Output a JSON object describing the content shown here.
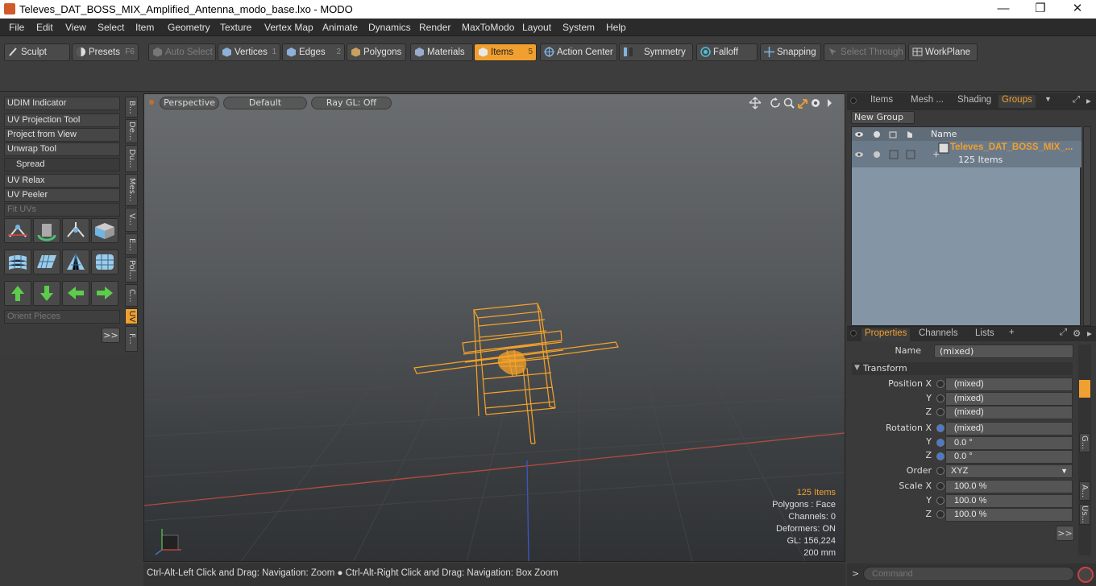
{
  "window": {
    "title": "Televes_DAT_BOSS_MIX_Amplified_Antenna_modo_base.lxo - MODO",
    "minimize": "—",
    "maximize": "❐",
    "close": "✕"
  },
  "menu": [
    "File",
    "Edit",
    "View",
    "Select",
    "Item",
    "Geometry",
    "Texture",
    "Vertex Map",
    "Animate",
    "Dynamics",
    "Render",
    "MaxToModo",
    "Layout",
    "System",
    "Help"
  ],
  "toolbar": {
    "sculpt": "Sculpt",
    "presets": "Presets",
    "presets_key": "F6",
    "auto_select": "Auto Select",
    "vertices": "Vertices",
    "vertices_key": "1",
    "edges": "Edges",
    "edges_key": "2",
    "polygons": "Polygons",
    "materials": "Materials",
    "items": "Items",
    "items_key": "5",
    "action_center": "Action Center",
    "symmetry": "Symmetry",
    "falloff": "Falloff",
    "snapping": "Snapping",
    "select_through": "Select Through",
    "workplane": "WorkPlane"
  },
  "left": {
    "buttons": [
      "UDIM Indicator",
      "UV Projection Tool",
      "Project from View",
      "Unwrap Tool",
      "Spread",
      "UV Relax",
      "UV Peeler",
      "Fit UVs"
    ],
    "orient": "Orient Pieces",
    "more": ">>",
    "tabs": [
      "B...",
      "De...",
      "Du...",
      "Mes...",
      "V...",
      "E...",
      "Pol...",
      "C...",
      "UV",
      "F..."
    ]
  },
  "viewport": {
    "perspective": "Perspective",
    "default": "Default",
    "raygl": "Ray GL: Off",
    "info": {
      "items": "125 Items",
      "polygons": "Polygons : Face",
      "channels": "Channels: 0",
      "deformers": "Deformers: ON",
      "gl": "GL: 156,224",
      "scale": "200 mm"
    }
  },
  "status": "Ctrl-Alt-Left Click and Drag: Navigation: Zoom ● Ctrl-Alt-Right Click and Drag: Navigation: Box Zoom",
  "groups": {
    "tabs": [
      "Items",
      "Mesh ...",
      "Shading",
      "Groups"
    ],
    "new_group": "New Group",
    "name_col": "Name",
    "group_name": "Televes_DAT_BOSS_MIX_...",
    "group_count": "125 Items"
  },
  "properties": {
    "tabs": [
      "Properties",
      "Channels",
      "Lists",
      "+"
    ],
    "name_label": "Name",
    "name_value": "(mixed)",
    "transform": "Transform",
    "rows": [
      {
        "label": "Position X",
        "value": "(mixed)"
      },
      {
        "label": "Y",
        "value": "(mixed)"
      },
      {
        "label": "Z",
        "value": "(mixed)"
      },
      {
        "label": "Rotation X",
        "value": "(mixed)"
      },
      {
        "label": "Y",
        "value": "0.0 °"
      },
      {
        "label": "Z",
        "value": "0.0 °"
      },
      {
        "label": "Order",
        "value": "XYZ"
      },
      {
        "label": "Scale X",
        "value": "100.0 %"
      },
      {
        "label": "Y",
        "value": "100.0 %"
      },
      {
        "label": "Z",
        "value": "100.0 %"
      }
    ],
    "more": ">>",
    "side_tabs": [
      "G...",
      "A...",
      "Us..."
    ]
  },
  "command": {
    "placeholder": "Command",
    "prompt": ">"
  },
  "colors": {
    "accent": "#f0a030",
    "wire": "#f7a328",
    "axis_red": "#b44b3f",
    "axis_blue": "#3d56c6"
  }
}
